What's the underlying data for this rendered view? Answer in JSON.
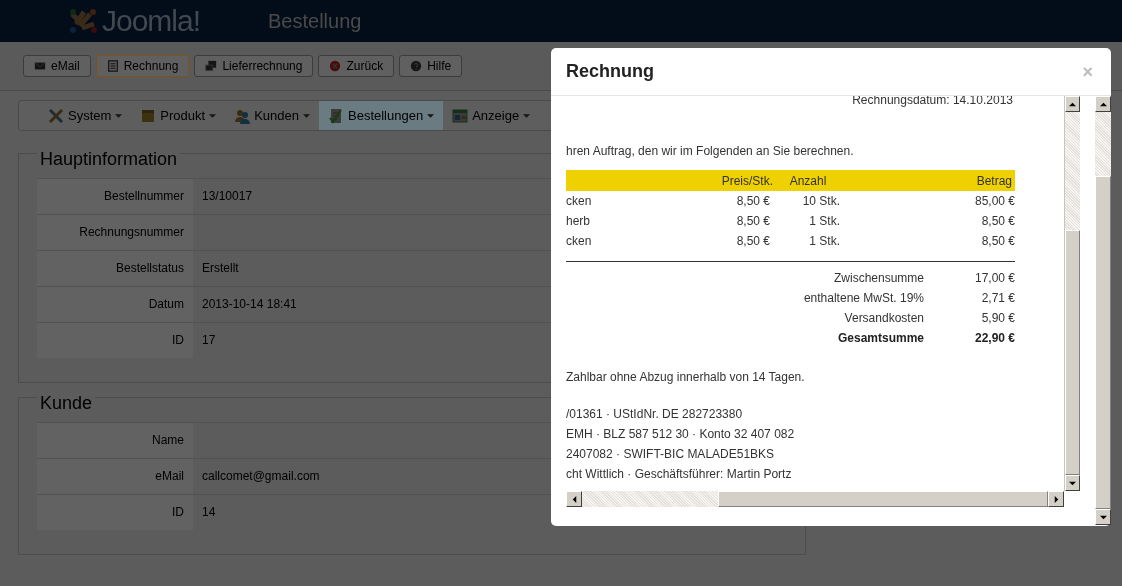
{
  "header": {
    "logo_text": "Joomla!",
    "title": "Bestellung"
  },
  "toolbar": [
    {
      "label": "eMail",
      "selected": false
    },
    {
      "label": "Rechnung",
      "selected": true
    },
    {
      "label": "Lieferrechnung",
      "selected": false
    },
    {
      "label": "Zurück",
      "selected": false
    },
    {
      "label": "Hilfe",
      "selected": false
    }
  ],
  "menu": [
    {
      "label": "System",
      "selected": false
    },
    {
      "label": "Produkt",
      "selected": false
    },
    {
      "label": "Kunden",
      "selected": false
    },
    {
      "label": "Bestellungen",
      "selected": true
    },
    {
      "label": "Anzeige",
      "selected": false
    }
  ],
  "sections": [
    {
      "title": "Hauptinformation",
      "rows": [
        {
          "label": "Bestellnummer",
          "value": "13/10017"
        },
        {
          "label": "Rechnungsnummer"
        },
        {
          "label": "Bestellstatus",
          "value": "Erstellt"
        },
        {
          "label": "Datum",
          "value": "2013-10-14 18:41"
        },
        {
          "label": "ID",
          "value": "17"
        }
      ]
    },
    {
      "title": "Kunde",
      "rows": [
        {
          "label": "Name"
        },
        {
          "label": "eMail",
          "value": "callcomet@gmail.com"
        },
        {
          "label": "ID",
          "value": "14"
        }
      ]
    }
  ],
  "modal": {
    "title": "Rechnung",
    "close": "×",
    "date_line": "Rechnungsdatum: 14.10.2013",
    "intro": "hren Auftrag, den wir im Folgenden an Sie berechnen.",
    "table": {
      "columns": [
        "Preis/Stk.",
        "Anzahl",
        "Betrag"
      ],
      "rows": [
        {
          "column_1": "cken",
          "price": "8,50 €",
          "quantity": "10 Stk.",
          "amount": "85,00 €"
        },
        {
          "column_1": "herb",
          "price": "8,50 €",
          "quantity": "1 Stk.",
          "amount": "8,50 €"
        },
        {
          "column_1": "cken",
          "price": "8,50 €",
          "quantity": "1 Stk.",
          "amount": "8,50 €"
        }
      ]
    },
    "totals": [
      {
        "label": "Zwischensumme",
        "value": "17,00 €",
        "bold": false
      },
      {
        "label": "enthaltene MwSt. 19%",
        "value": "2,71 €",
        "bold": false
      },
      {
        "label": "Versandkosten",
        "value": "5,90 €",
        "bold": false
      },
      {
        "label": "Gesamtsumme",
        "value": "22,90 €",
        "bold": true
      }
    ],
    "payment_note": "Zahlbar ohne Abzug innerhalb von 14 Tagen.",
    "footer_lines": [
      "/01361 · UStIdNr. DE 282723380",
      "EMH · BLZ 587 512 30 · Konto 32 407 082",
      "2407082 · SWIFT-BIC MALADE51BKS",
      "cht Wittlich · Geschäftsführer: Martin Portz"
    ]
  }
}
